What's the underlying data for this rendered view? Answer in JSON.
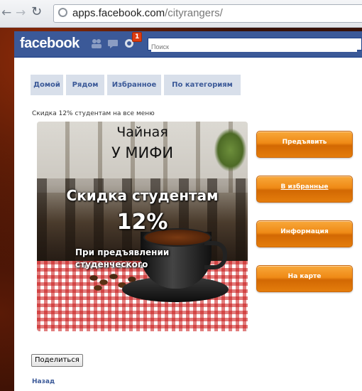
{
  "browser": {
    "url_host": "apps.facebook.com",
    "url_path": "/cityrangers/"
  },
  "fb_header": {
    "logo": "facebook",
    "notification_count": "1",
    "search_placeholder": "Поиск",
    "brand_color": "#3b5998"
  },
  "tabs": [
    {
      "label": "Домой"
    },
    {
      "label": "Рядом"
    },
    {
      "label": "Избранное"
    },
    {
      "label": "По категориям"
    }
  ],
  "offer": {
    "caption": "Скидка 12% студентам на все меню",
    "title_line1": "Чайная",
    "title_line2": "У МИФИ",
    "discount_text": "Скидка студентам",
    "discount_percent": "12%",
    "note": "При предъявлении студенческого"
  },
  "actions": [
    {
      "label": "Предъявить"
    },
    {
      "label": "В избранные"
    },
    {
      "label": "Информация"
    },
    {
      "label": "На карте"
    }
  ],
  "share_label": "Поделиться",
  "back_label": "Назад",
  "icons": [
    "back-icon",
    "forward-icon",
    "reload-icon",
    "globe-icon",
    "friends-icon",
    "messages-icon",
    "notifications-icon"
  ]
}
